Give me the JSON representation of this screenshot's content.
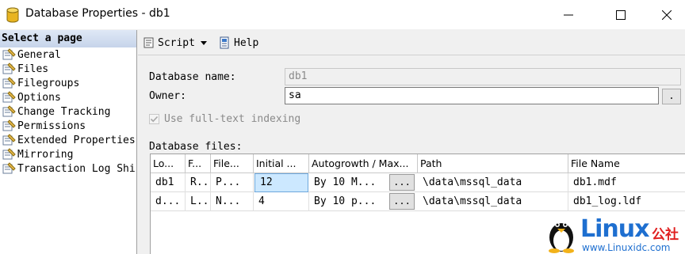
{
  "window": {
    "title": "Database Properties - db1"
  },
  "left_pane": {
    "header": "Select a page",
    "items": [
      {
        "label": "General"
      },
      {
        "label": "Files"
      },
      {
        "label": "Filegroups"
      },
      {
        "label": "Options"
      },
      {
        "label": "Change Tracking"
      },
      {
        "label": "Permissions"
      },
      {
        "label": "Extended Properties"
      },
      {
        "label": "Mirroring"
      },
      {
        "label": "Transaction Log Shi"
      }
    ]
  },
  "toolbar": {
    "script_label": "Script",
    "help_label": "Help"
  },
  "form": {
    "database_name_label": "Database name:",
    "database_name_value": "db1",
    "owner_label": "Owner:",
    "owner_value": "sa",
    "owner_browse": ".",
    "fulltext_label": "Use full-text indexing",
    "fulltext_checked": true,
    "files_label": "Database files:"
  },
  "grid": {
    "columns": [
      "Lo...",
      "F...",
      "File...",
      "Initial ...",
      "Autogrowth / Max...",
      "Path",
      "File Name"
    ],
    "rows": [
      {
        "logical": "db1",
        "filetype": "R...",
        "filegroup": "P...",
        "initial": "12",
        "autogrowth": "By 10 M...",
        "browse": "...",
        "path": "\\data\\mssql_data",
        "filename": "db1.mdf"
      },
      {
        "logical": "d...",
        "filetype": "L...",
        "filegroup": "N...",
        "initial": "4",
        "autogrowth": "By 10 p...",
        "browse": "...",
        "path": "\\data\\mssql_data",
        "filename": "db1_log.ldf"
      }
    ]
  },
  "watermark": {
    "brand": "Linux",
    "brand_cn": "公社",
    "url": "www.Linuxidc.com"
  },
  "colors": {
    "selection": "#cce8ff",
    "watermark_blue": "#1e6fd0"
  }
}
